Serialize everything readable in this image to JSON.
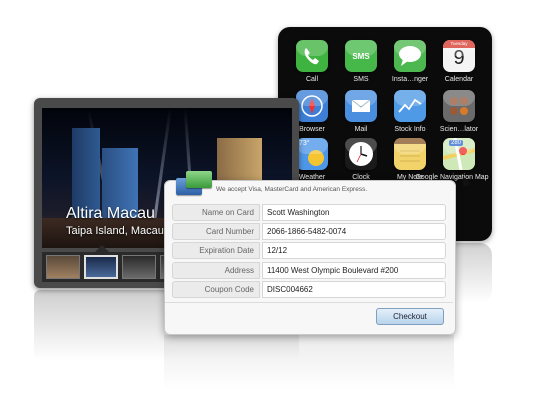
{
  "apps": [
    {
      "label": "Call",
      "icon": "phone-icon",
      "color": "#3fb33f"
    },
    {
      "label": "SMS",
      "icon": "sms-icon",
      "color": "#46b84a"
    },
    {
      "label": "Insta…nger",
      "icon": "chat-bubble-icon",
      "color": "#4db84f"
    },
    {
      "label": "Calendar",
      "icon": "calendar-icon",
      "color": "#f4f4f4",
      "day": "9",
      "month": "Tuesday"
    },
    {
      "label": "Browser",
      "icon": "compass-icon",
      "color": "#3d7fd6"
    },
    {
      "label": "Mail",
      "icon": "mail-icon",
      "color": "#4a8ee0"
    },
    {
      "label": "Stock Info",
      "icon": "stock-chart-icon",
      "color": "#4f9ae6"
    },
    {
      "label": "Scien…lator",
      "icon": "calculator-icon",
      "color": "#6a6a6a"
    },
    {
      "label": "Weather",
      "icon": "weather-icon",
      "color": "#4e97e8"
    },
    {
      "label": "Clock",
      "icon": "clock-icon",
      "color": "#1a1a1a"
    },
    {
      "label": "My Note",
      "icon": "notepad-icon",
      "color": "#f2d36a"
    },
    {
      "label": "Google Navigation Map",
      "icon": "map-icon",
      "color": "#7fbf5a"
    }
  ],
  "weather": {
    "temp": "73°"
  },
  "map": {
    "badge": "280"
  },
  "gallery": {
    "title": "Altira Macau",
    "subtitle": "Taipa Island, Macau"
  },
  "form": {
    "accept_text": "We accept Visa, MasterCard and American Express.",
    "fields": [
      {
        "label": "Name on Card",
        "value": "Scott Washington"
      },
      {
        "label": "Card Number",
        "value": "2066-1866-5482-0074"
      },
      {
        "label": "Expiration Date",
        "value": "12/12"
      },
      {
        "label": "Address",
        "value": "11400 West Olympic Boulevard #200"
      },
      {
        "label": "Coupon Code",
        "value": "DISC004662"
      }
    ],
    "checkout_label": "Checkout"
  }
}
